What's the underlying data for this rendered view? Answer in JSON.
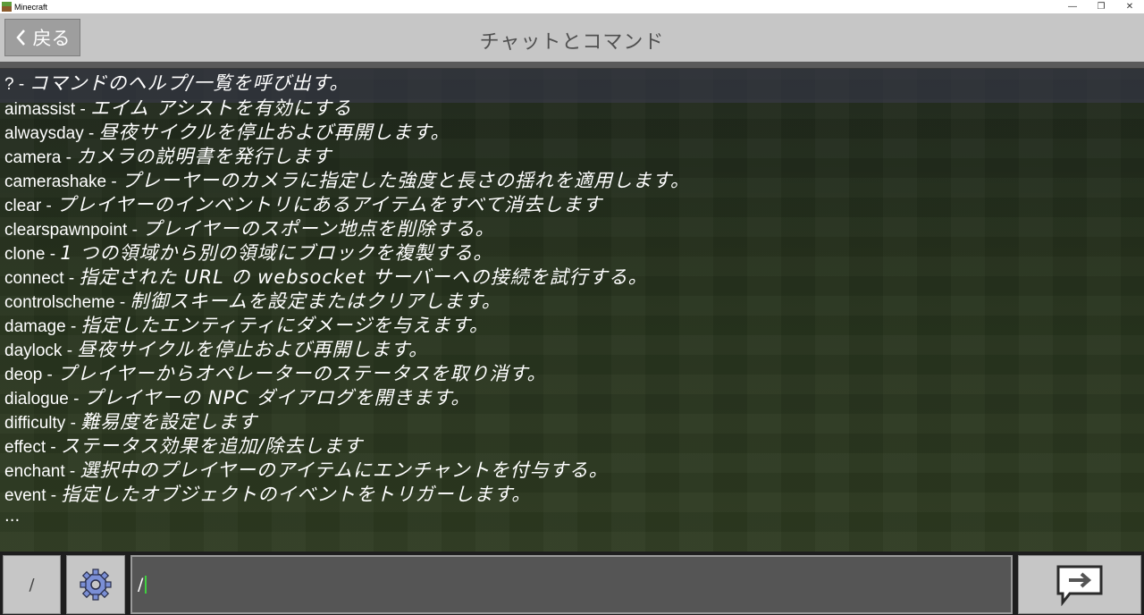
{
  "window": {
    "title": "Minecraft",
    "minimize": "—",
    "restore": "❐",
    "close": "✕"
  },
  "header": {
    "back_label": "戻る",
    "title": "チャットとコマンド"
  },
  "chat": {
    "lines": [
      {
        "cmd": "?",
        "desc": "コマンドのヘルプ/一覧を呼び出す。"
      },
      {
        "cmd": "aimassist",
        "desc": "エイム アシストを有効にする"
      },
      {
        "cmd": "alwaysday",
        "desc": "昼夜サイクルを停止および再開します。"
      },
      {
        "cmd": "camera",
        "desc": "カメラの説明書を発行します"
      },
      {
        "cmd": "camerashake",
        "desc": "プレーヤーのカメラに指定した強度と長さの揺れを適用します。"
      },
      {
        "cmd": "clear",
        "desc": "プレイヤーのインベントリにあるアイテムをすべて消去します"
      },
      {
        "cmd": "clearspawnpoint",
        "desc": "プレイヤーのスポーン地点を削除する。"
      },
      {
        "cmd": "clone",
        "desc": "1 つの領域から別の領域にブロックを複製する。"
      },
      {
        "cmd": "connect",
        "desc": "指定された URL の websocket サーバーへの接続を試行する。"
      },
      {
        "cmd": "controlscheme",
        "desc": "制御スキームを設定またはクリアします。"
      },
      {
        "cmd": "damage",
        "desc": "指定したエンティティにダメージを与えます。"
      },
      {
        "cmd": "daylock",
        "desc": "昼夜サイクルを停止および再開します。"
      },
      {
        "cmd": "deop",
        "desc": "プレイヤーからオペレーターのステータスを取り消す。"
      },
      {
        "cmd": "dialogue",
        "desc": "プレイヤーの NPC ダイアログを開きます。"
      },
      {
        "cmd": "difficulty",
        "desc": "難易度を設定します"
      },
      {
        "cmd": "effect",
        "desc": "ステータス効果を追加/除去します"
      },
      {
        "cmd": "enchant",
        "desc": "選択中のプレイヤーのアイテムにエンチャントを付与する。"
      },
      {
        "cmd": "event",
        "desc": "指定したオブジェクトのイベントをトリガーします。"
      }
    ],
    "separator": " - ",
    "more": "..."
  },
  "input": {
    "slash_button": "/",
    "value": "/"
  },
  "icons": {
    "back": "chevron-left-icon",
    "settings": "gear-icon",
    "send": "send-arrow-icon"
  },
  "colors": {
    "header_bg": "#c6c6c6",
    "input_bg": "#555555",
    "caret": "#3fd13f"
  }
}
